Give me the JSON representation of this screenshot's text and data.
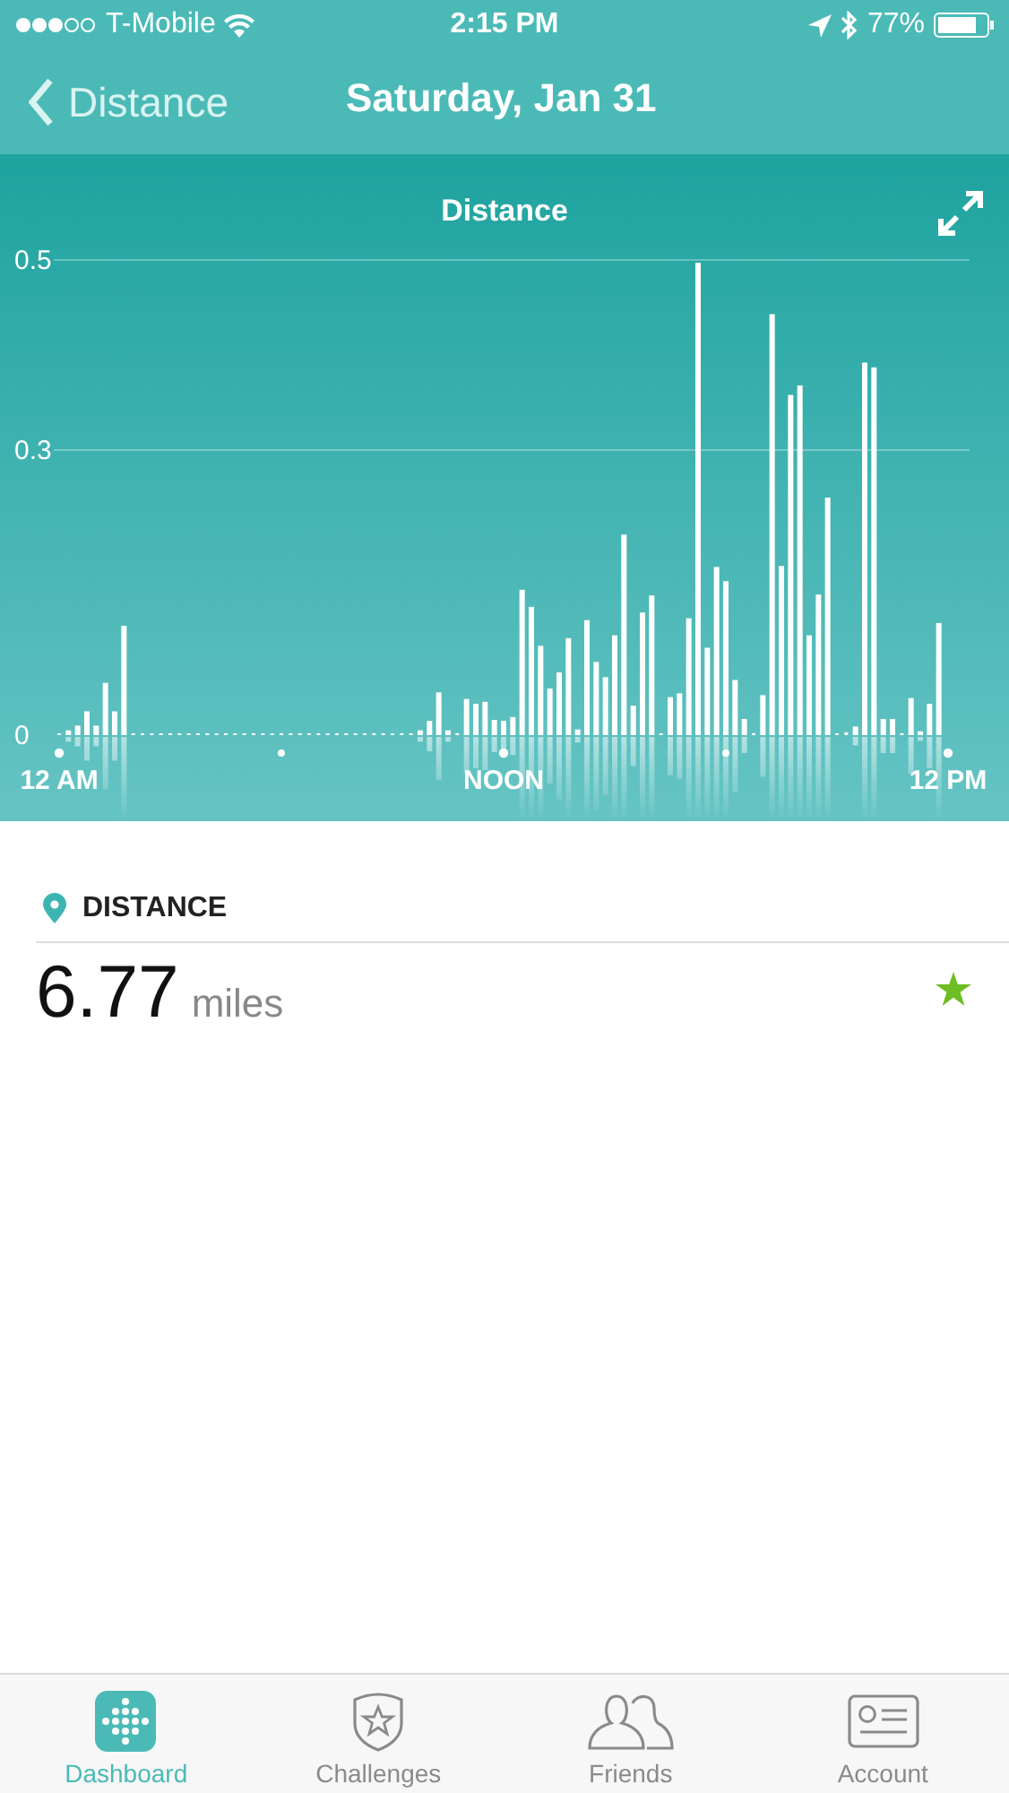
{
  "status_bar": {
    "carrier": "T-Mobile",
    "time": "2:15 PM",
    "battery": "77%"
  },
  "nav_bar": {
    "back_label": "Distance",
    "title": "Saturday, Jan 31"
  },
  "chart_panel": {
    "chart_data": {
      "type": "bar",
      "title": "Distance",
      "categories": [
        "12 AM",
        null,
        null,
        null,
        null,
        null,
        null,
        null,
        null,
        null,
        null,
        null,
        null,
        null,
        null,
        null,
        null,
        null,
        null,
        null,
        null,
        null,
        null,
        null,
        null,
        null,
        null,
        null,
        null,
        null,
        null,
        null,
        null,
        null,
        null,
        null,
        null,
        null,
        null,
        null,
        null,
        null,
        null,
        null,
        null,
        null,
        null,
        null,
        "NOON",
        null,
        null,
        null,
        null,
        null,
        null,
        null,
        null,
        null,
        null,
        null,
        null,
        null,
        null,
        null,
        null,
        null,
        null,
        null,
        null,
        null,
        null,
        null,
        null,
        null,
        null,
        null,
        null,
        null,
        null,
        null,
        null,
        null,
        null,
        null,
        null,
        null,
        null,
        null,
        null,
        null,
        null,
        null,
        null,
        null,
        null,
        null,
        "12 PM"
      ],
      "series": [
        {
          "color": "#ffffff",
          "values": [
            0,
            0.005,
            0.01,
            0.025,
            0.01,
            0.055,
            0.025,
            0.115,
            0,
            0,
            0,
            0,
            0,
            0,
            0,
            0,
            0,
            0,
            0,
            0,
            0,
            0,
            0,
            0,
            0,
            0,
            0,
            0,
            0,
            0,
            0,
            0,
            0,
            0,
            0,
            0,
            0,
            0,
            0,
            0.005,
            0.015,
            0.045,
            0.005,
            0.002,
            0.038,
            0.033,
            0.035,
            0.016,
            0.015,
            0.019,
            0.153,
            0.135,
            0.094,
            0.049,
            0.066,
            0.102,
            0.006,
            0.121,
            0.077,
            0.061,
            0.105,
            0.211,
            0.031,
            0.129,
            0.147,
            0.001,
            0.04,
            0.044,
            0.123,
            0.497,
            0.092,
            0.177,
            0.162,
            0.058,
            0.017,
            0.002,
            0.042,
            0.443,
            0.178,
            0.358,
            0.368,
            0.105,
            0.148,
            0.25,
            0,
            0.003,
            0.009,
            0.392,
            0.387,
            0.017,
            0.017,
            0,
            0.039,
            0.004,
            0.033,
            0.118,
            null
          ]
        }
      ],
      "ylim": [
        0,
        0.5
      ],
      "yticks": [
        0,
        0.3,
        0.5
      ]
    }
  },
  "stat": {
    "heading": "DISTANCE",
    "value": "6.77",
    "unit": "miles",
    "goal_reached": true
  },
  "tab_bar": [
    {
      "label": "Dashboard",
      "kind": "dashboard",
      "selected": true
    },
    {
      "label": "Challenges",
      "kind": "challenges",
      "selected": false
    },
    {
      "label": "Friends",
      "kind": "friends",
      "selected": false
    },
    {
      "label": "Account",
      "kind": "account",
      "selected": false
    }
  ]
}
